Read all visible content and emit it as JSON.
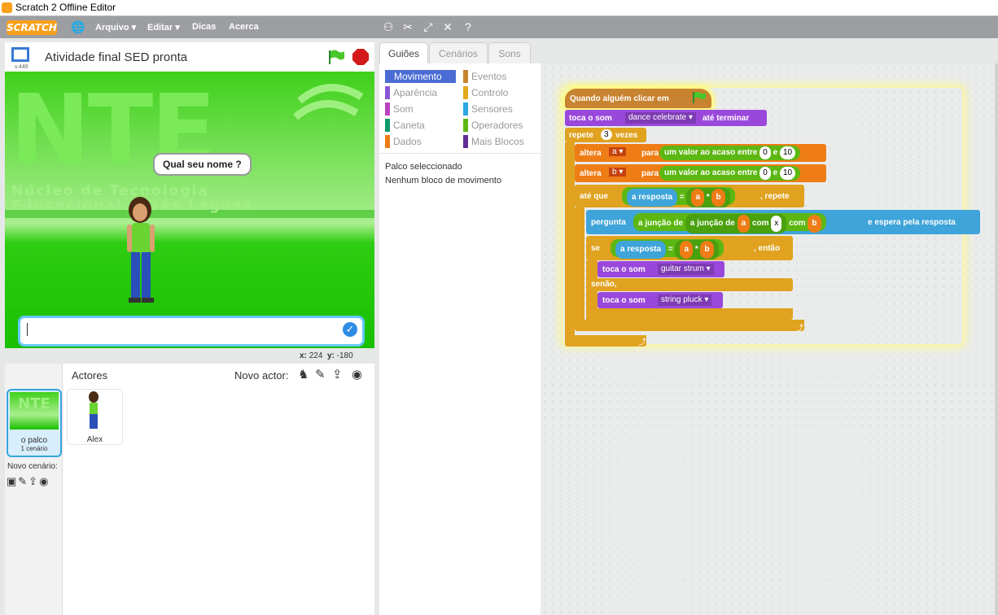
{
  "window": {
    "title": "Scratch 2 Offline Editor"
  },
  "menu": {
    "logo": "SCRATCH",
    "items": [
      "Arquivo ▾",
      "Editar ▾",
      "Dicas",
      "Acerca"
    ]
  },
  "stage": {
    "project_title": "Atividade final  SED pronta",
    "version": "v.446",
    "nte_big": "NTE",
    "nte_line1": "Núcleo de Tecnologia",
    "nte_line2": "Educacional - Três Lagoas",
    "speech": "Qual seu nome ?",
    "coords": {
      "x_label": "x:",
      "x": "224",
      "y_label": "y:",
      "y": "-180"
    }
  },
  "sprites": {
    "header": "Actores",
    "new_sprite": "Novo actor:",
    "stage_name": "o palco",
    "stage_costumes": "1 cenário",
    "new_backdrop": "Novo cenário:",
    "sprite_name": "Alex"
  },
  "tabs": [
    "Guiões",
    "Cenários",
    "Sons"
  ],
  "palette": {
    "categories_left": [
      {
        "name": "Movimento",
        "color": "#4a6cd4",
        "selected": true
      },
      {
        "name": "Aparência",
        "color": "#8a55d7"
      },
      {
        "name": "Som",
        "color": "#bb42c3"
      },
      {
        "name": "Caneta",
        "color": "#0e9a6c"
      },
      {
        "name": "Dados",
        "color": "#ee7d16"
      }
    ],
    "categories_right": [
      {
        "name": "Eventos",
        "color": "#c88330"
      },
      {
        "name": "Controlo",
        "color": "#e1a91a"
      },
      {
        "name": "Sensores",
        "color": "#2ca5e2"
      },
      {
        "name": "Operadores",
        "color": "#5cb712"
      },
      {
        "name": "Mais Blocos",
        "color": "#632d99"
      }
    ],
    "info1": "Palco seleccionado",
    "info2": "Nenhum bloco de movimento"
  },
  "script": {
    "hat": "Quando alguém clicar em",
    "play_sound_until": "toca o som",
    "sound1": "dance celebrate",
    "until_done": "até terminar",
    "repeat": "repete",
    "repeat_n": "3",
    "times": "vezes",
    "set": "altera",
    "var_a": "a",
    "var_b": "b",
    "to": "para",
    "random": "um valor ao acaso entre",
    "r_from": "0",
    "r_and": "e",
    "r_to": "10",
    "until": "até que",
    "answer": "a resposta",
    "eq": "=",
    "times_op": "*",
    "repeat_suffix": ", repete",
    "ask": "pergunta",
    "join": "a junção de",
    "with": "com",
    "x_str": "x",
    "and_wait": "e espera pela resposta",
    "if": "se",
    "then": ", então",
    "play_sound": "toca o som",
    "sound2": "guitar strum",
    "else": "senão,",
    "sound3": "string pluck"
  }
}
